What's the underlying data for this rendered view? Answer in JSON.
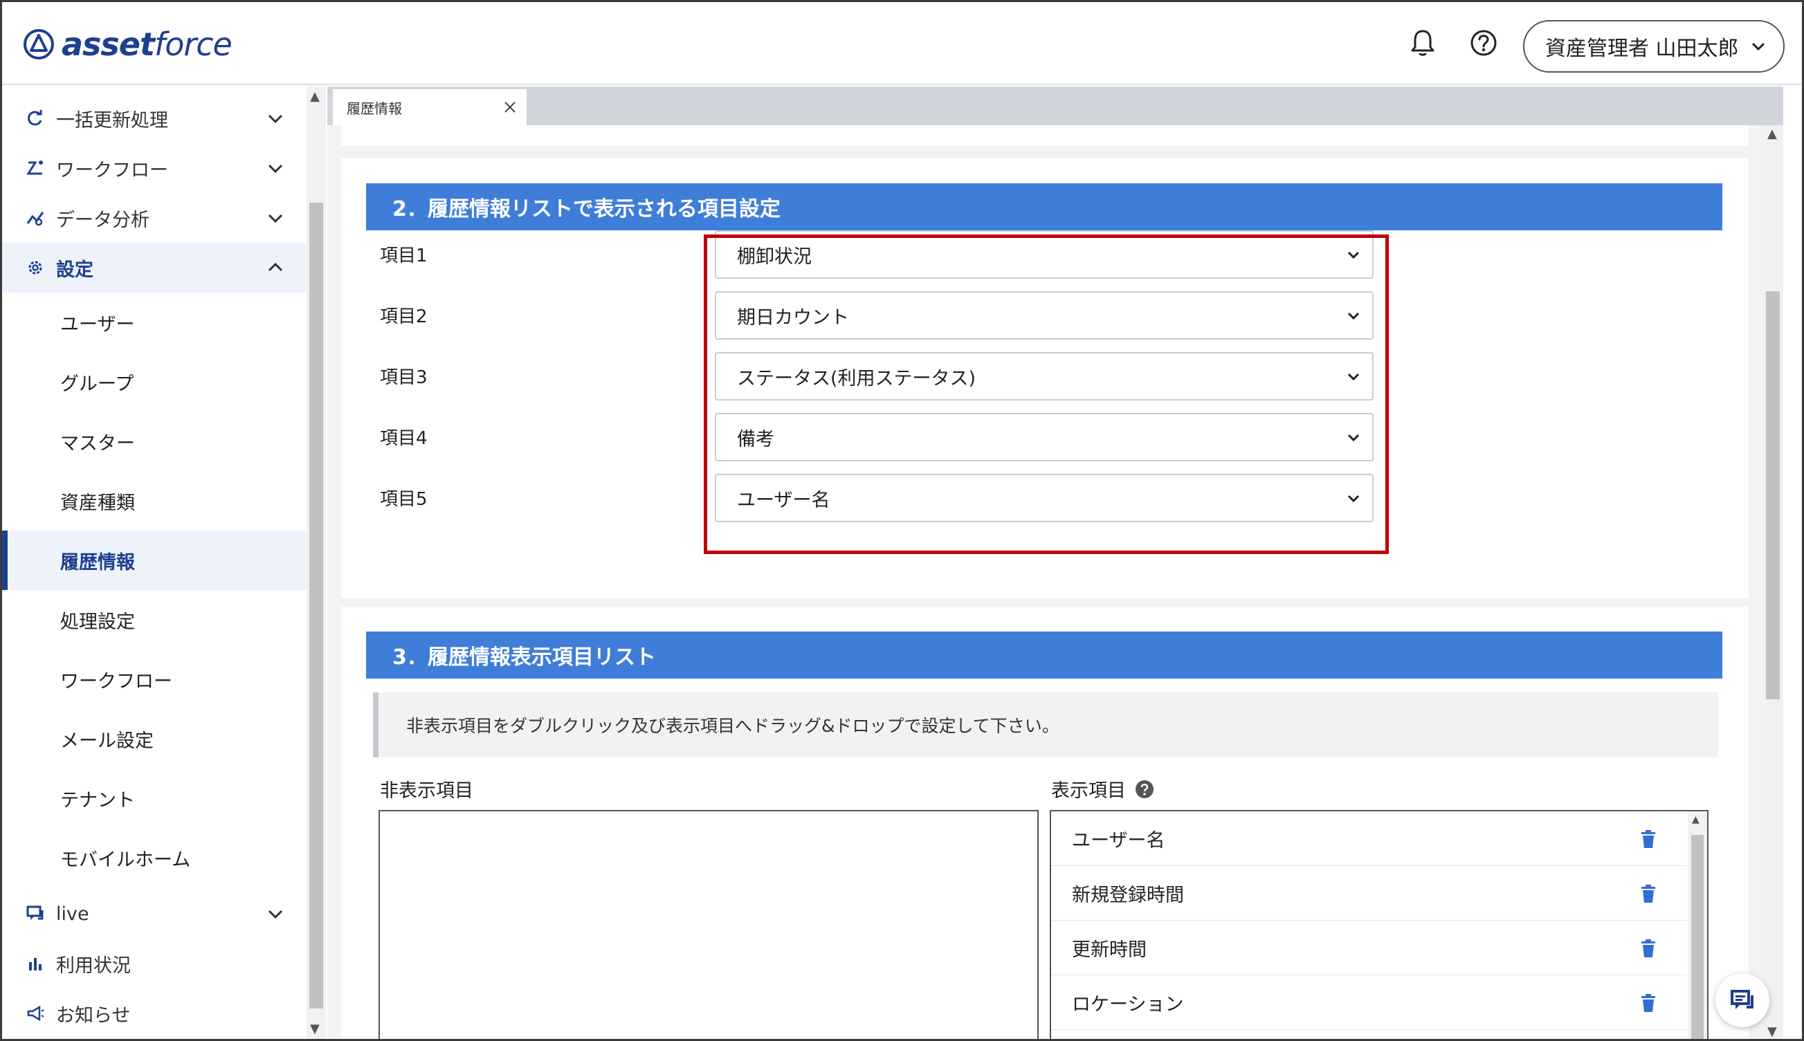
{
  "app": {
    "logo_bold": "asset",
    "logo_light": "force"
  },
  "header": {
    "user_label": "資産管理者 山田太郎"
  },
  "sidebar": {
    "groups": [
      {
        "label": "一括更新処理",
        "icon": "refresh-icon"
      },
      {
        "label": "ワークフロー",
        "icon": "workflow-icon"
      },
      {
        "label": "データ分析",
        "icon": "analytics-icon"
      },
      {
        "label": "設定",
        "icon": "gear-icon"
      }
    ],
    "settings_items": [
      "ユーザー",
      "グループ",
      "マスター",
      "資産種類",
      "履歴情報",
      "処理設定",
      "ワークフロー",
      "メール設定",
      "テナント",
      "モバイルホーム"
    ],
    "bottom_items": [
      {
        "label": "live",
        "icon": "chat-icon"
      },
      {
        "label": "利用状況",
        "icon": "bar-chart-icon"
      },
      {
        "label": "お知らせ",
        "icon": "megaphone-icon"
      }
    ]
  },
  "tabs": [
    {
      "label": "履歴情報"
    }
  ],
  "section2": {
    "title": "2．履歴情報リストで表示される項目設定",
    "rows": [
      {
        "label": "項目1",
        "value": "棚卸状況"
      },
      {
        "label": "項目2",
        "value": "期日カウント"
      },
      {
        "label": "項目3",
        "value": "ステータス(利用ステータス)"
      },
      {
        "label": "項目4",
        "value": "備考"
      },
      {
        "label": "項目5",
        "value": "ユーザー名"
      }
    ]
  },
  "section3": {
    "title": "3．履歴情報表示項目リスト",
    "info": "非表示項目をダブルクリック及び表示項目へドラッグ&ドロップで設定して下さい。",
    "hidden_label": "非表示項目",
    "shown_label": "表示項目",
    "shown_items": [
      "ユーザー名",
      "新規登録時間",
      "更新時間",
      "ロケーション"
    ]
  },
  "colors": {
    "brand": "#1d3f8f",
    "section_header": "#3f7ed8",
    "highlight": "#c00000"
  }
}
